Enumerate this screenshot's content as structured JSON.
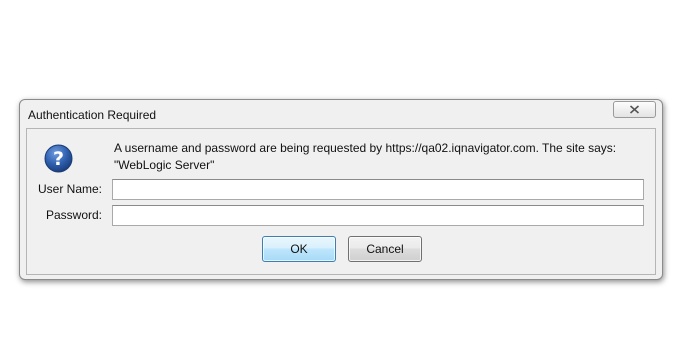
{
  "dialog": {
    "title": "Authentication Required",
    "close_icon": "close-icon",
    "help_icon": "question-mark-icon",
    "message_line1": "A username and password are being requested by https://qa02.iqnavigator.com. The site says:",
    "message_line2": "\"WebLogic Server\"",
    "username_label": "User Name:",
    "username_value": "",
    "password_label": "Password:",
    "password_value": "",
    "ok_label": "OK",
    "cancel_label": "Cancel"
  },
  "colors": {
    "dialog_background": "#f0f0f0",
    "help_icon_blue": "#2e5fae",
    "ok_button_border": "#3c7fb1"
  }
}
